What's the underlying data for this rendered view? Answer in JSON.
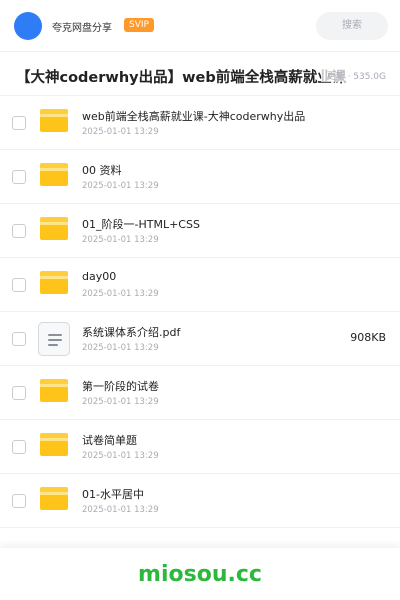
{
  "header": {
    "site_name": "夸克网盘分享",
    "vip_badge": "SVIP",
    "search_label": "搜索"
  },
  "share": {
    "title": "【大神coderwhy出品】web前端全栈高薪就业课",
    "meta": "更新 · 535.0G"
  },
  "files": [
    {
      "type": "folder",
      "name": "web前端全栈高薪就业课-大神coderwhy出品",
      "date": "2025-01-01 13:29",
      "size": ""
    },
    {
      "type": "folder",
      "name": "00 资料",
      "date": "2025-01-01 13:29",
      "size": ""
    },
    {
      "type": "folder",
      "name": "01_阶段一-HTML+CSS",
      "date": "2025-01-01 13:29",
      "size": ""
    },
    {
      "type": "folder",
      "name": "day00",
      "date": "2025-01-01 13:29",
      "size": ""
    },
    {
      "type": "document",
      "name": "系统课体系介绍.pdf",
      "date": "2025-01-01 13:29",
      "size": "908KB"
    },
    {
      "type": "folder",
      "name": "第一阶段的试卷",
      "date": "2025-01-01 13:29",
      "size": ""
    },
    {
      "type": "folder",
      "name": "试卷简单题",
      "date": "2025-01-01 13:29",
      "size": ""
    },
    {
      "type": "folder",
      "name": "01-水平居中",
      "date": "2025-01-01 13:29",
      "size": ""
    }
  ],
  "footer": {
    "brand": "miosou.cc"
  },
  "colors": {
    "accent": "#2e7cf6",
    "vip": "#ff9a2a",
    "folder": "#ffc41a",
    "footer_brand": "#2db83d"
  }
}
